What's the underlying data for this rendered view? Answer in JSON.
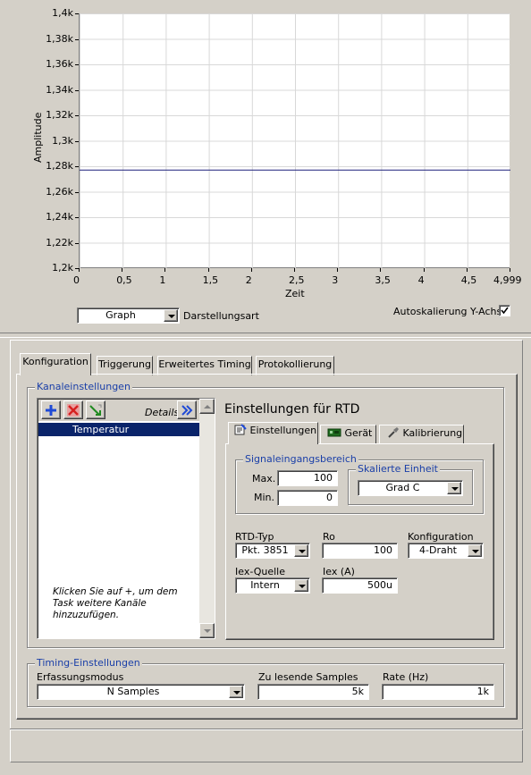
{
  "graph": {
    "ylabel": "Amplitude",
    "xlabel": "Zeit",
    "yticks": [
      "1,4k",
      "1,38k",
      "1,36k",
      "1,34k",
      "1,32k",
      "1,3k",
      "1,28k",
      "1,26k",
      "1,24k",
      "1,22k",
      "1,2k"
    ],
    "xticks": [
      "0",
      "0,5",
      "1",
      "1,5",
      "2",
      "2,5",
      "3",
      "3,5",
      "4",
      "4,5",
      "4,999"
    ],
    "display_mode_value": "Graph",
    "display_mode_label": "Darstellungsart",
    "autoscale_label": "Autoskalierung Y-Achse",
    "autoscale_checked": true,
    "line_color": "#1b1f7a"
  },
  "chart_data": {
    "type": "line",
    "xlabel": "Zeit",
    "ylabel": "Amplitude",
    "xlim": [
      0,
      4.999
    ],
    "ylim": [
      1200,
      1400
    ],
    "series": [
      {
        "x": [
          0,
          4.999
        ],
        "y": [
          1277,
          1277
        ]
      }
    ]
  },
  "tabs": [
    "Konfiguration",
    "Triggerung",
    "Erweitertes Timing",
    "Protokollierung"
  ],
  "channel_settings": {
    "title": "Kanaleinstellungen",
    "details_label": "Details",
    "channels": [
      "Temperatur"
    ],
    "hint": "Klicken Sie auf +, um dem Task weitere Kanäle hinzuzufügen."
  },
  "rtd": {
    "heading": "Einstellungen für RTD",
    "subtabs": [
      "Einstellungen",
      "Gerät",
      "Kalibrierung"
    ],
    "signal_range_title": "Signaleingangsbereich",
    "max_label": "Max.",
    "max_value": "100",
    "min_label": "Min.",
    "min_value": "0",
    "scaled_unit_title": "Skalierte Einheit",
    "scaled_unit_value": "Grad C",
    "rtd_type_label": "RTD-Typ",
    "rtd_type_value": "Pkt. 3851",
    "ro_label": "Ro",
    "ro_value": "100",
    "config_label": "Konfiguration",
    "config_value": "4-Draht",
    "iex_source_label": "Iex-Quelle",
    "iex_source_value": "Intern",
    "iex_label": "Iex (A)",
    "iex_value": "500u"
  },
  "timing": {
    "title": "Timing-Einstellungen",
    "mode_label": "Erfassungsmodus",
    "mode_value": "N Samples",
    "samples_label": "Zu lesende Samples",
    "samples_value": "5k",
    "rate_label": "Rate (Hz)",
    "rate_value": "1k"
  }
}
